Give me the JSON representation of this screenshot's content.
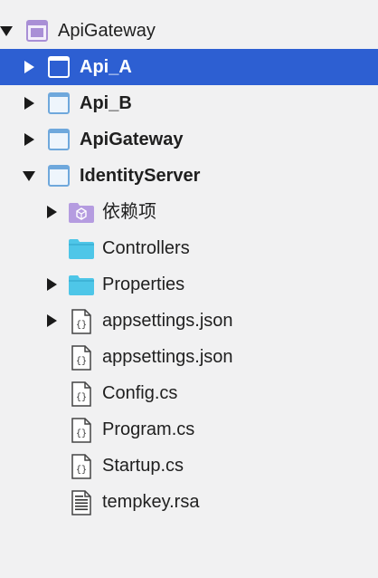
{
  "tree": {
    "solution": {
      "label": "ApiGateway",
      "icon": "solution-icon",
      "expanded": true
    },
    "projects": [
      {
        "label": "Api_A",
        "icon": "project-icon",
        "expanded": false,
        "selected": true
      },
      {
        "label": "Api_B",
        "icon": "project-icon",
        "expanded": false,
        "selected": false
      },
      {
        "label": "ApiGateway",
        "icon": "project-icon",
        "expanded": false,
        "selected": false
      },
      {
        "label": "IdentityServer",
        "icon": "project-icon",
        "expanded": true,
        "selected": false
      }
    ],
    "identity_children": [
      {
        "label": "依赖项",
        "icon": "dependencies-icon",
        "expandable": true
      },
      {
        "label": "Controllers",
        "icon": "folder-icon",
        "expandable": false
      },
      {
        "label": "Properties",
        "icon": "folder-icon",
        "expandable": true
      },
      {
        "label": "appsettings.json",
        "icon": "json-file-icon",
        "expandable": true
      },
      {
        "label": "appsettings.json",
        "icon": "json-file-icon",
        "expandable": false
      },
      {
        "label": "Config.cs",
        "icon": "code-file-icon",
        "expandable": false
      },
      {
        "label": "Program.cs",
        "icon": "code-file-icon",
        "expandable": false
      },
      {
        "label": "Startup.cs",
        "icon": "code-file-icon",
        "expandable": false
      },
      {
        "label": "tempkey.rsa",
        "icon": "text-file-icon",
        "expandable": false
      }
    ]
  },
  "colors": {
    "background": "#f1f1f2",
    "selection": "#2d5fd2",
    "solution_icon": "#a98fd6",
    "project_icon": "#6fa8dc",
    "folder_icon": "#4ec6e8",
    "dependencies_icon": "#b59ce0"
  }
}
